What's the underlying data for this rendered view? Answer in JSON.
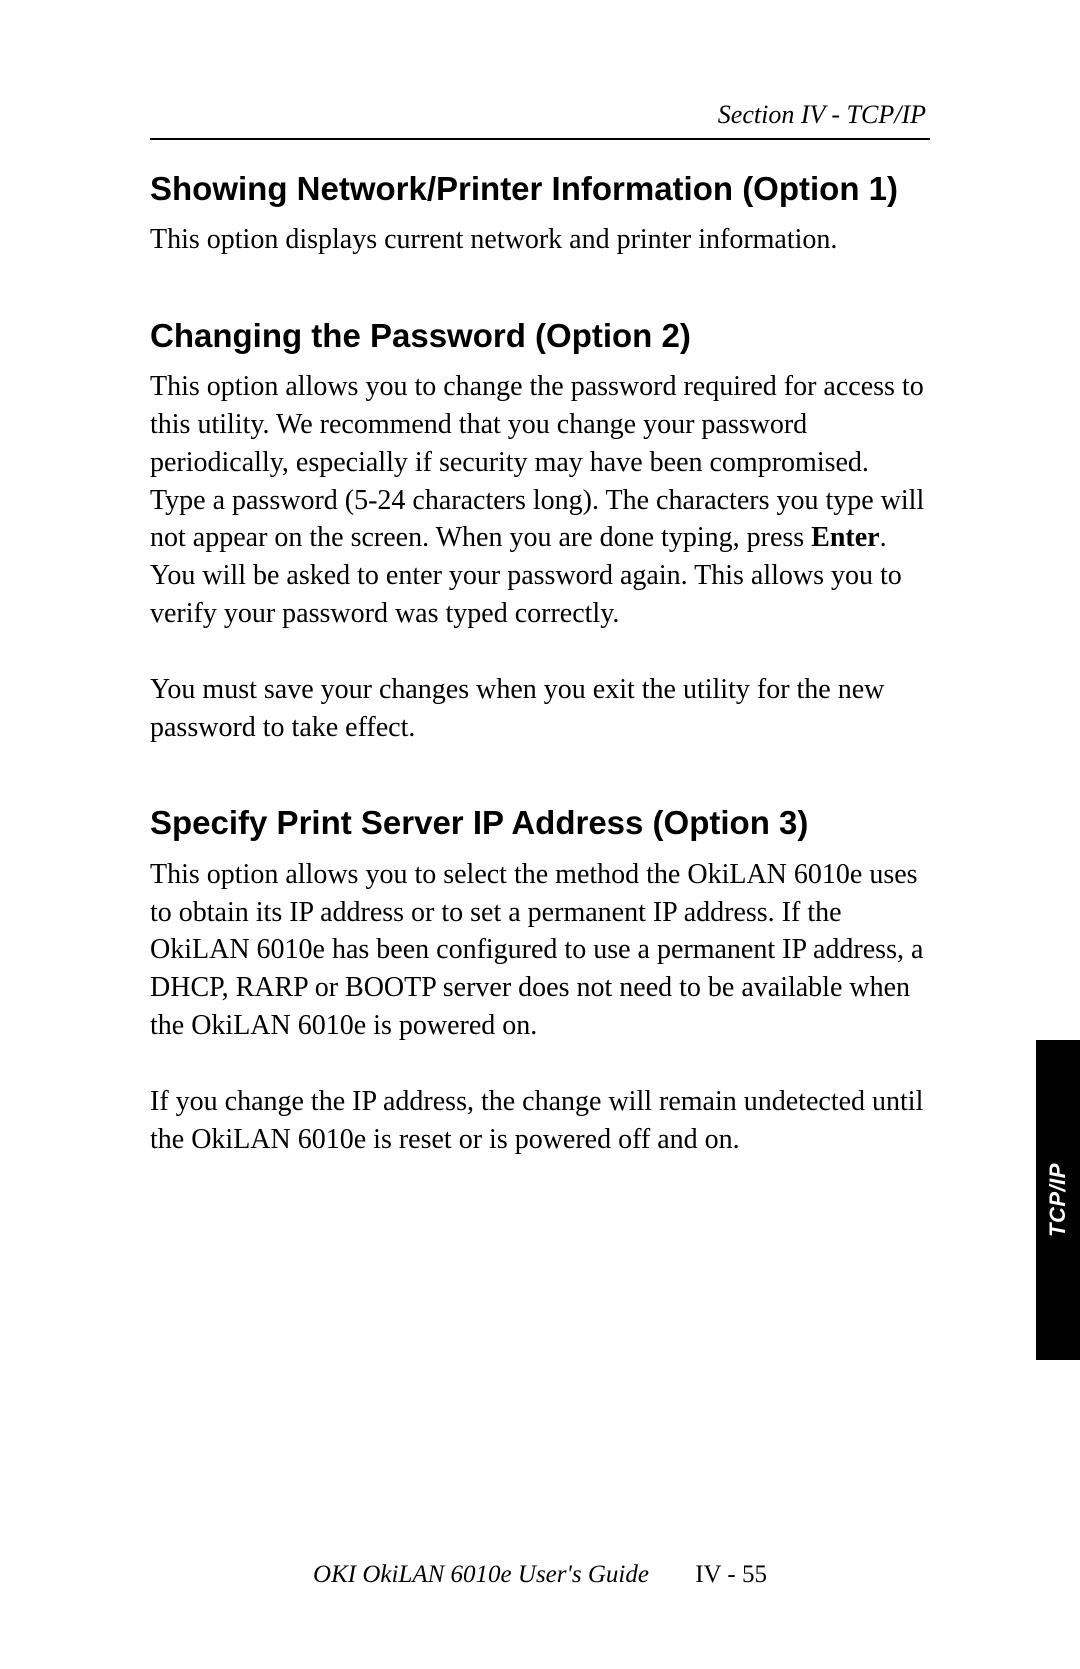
{
  "header": {
    "section_label": "Section IV - TCP/IP"
  },
  "sections": {
    "s1": {
      "heading": "Showing Network/Printer Information (Option 1)",
      "para1": "This option displays current network and printer information."
    },
    "s2": {
      "heading": "Changing the Password (Option 2)",
      "para1_part1": "This option allows you to change the password required for access to this utility. We recommend that you change your password periodically, especially if security may have been compromised. Type a password (5-24 characters long). The characters you type will not appear on the screen. When you are done typing, press ",
      "para1_bold": "Enter",
      "para1_part2": ". You will be asked to enter your password again. This allows you to verify your password was typed correctly.",
      "para2": "You must save your changes when you exit the utility for the new password to take effect."
    },
    "s3": {
      "heading": "Specify Print Server IP Address (Option 3)",
      "para1": "This option allows you to select the method the OkiLAN 6010e uses to obtain its IP address or to set a permanent IP address. If the OkiLAN 6010e has been configured to use a permanent IP address, a DHCP, RARP or BOOTP server does not need to be available when the OkiLAN 6010e is powered on.",
      "para2": "If you change the IP address, the change will remain undetected until the OkiLAN 6010e is reset or is powered off and on."
    }
  },
  "side_tab": {
    "label": "TCP/IP"
  },
  "footer": {
    "guide_title": "OKI OkiLAN 6010e User's Guide",
    "page_number": "IV - 55"
  }
}
